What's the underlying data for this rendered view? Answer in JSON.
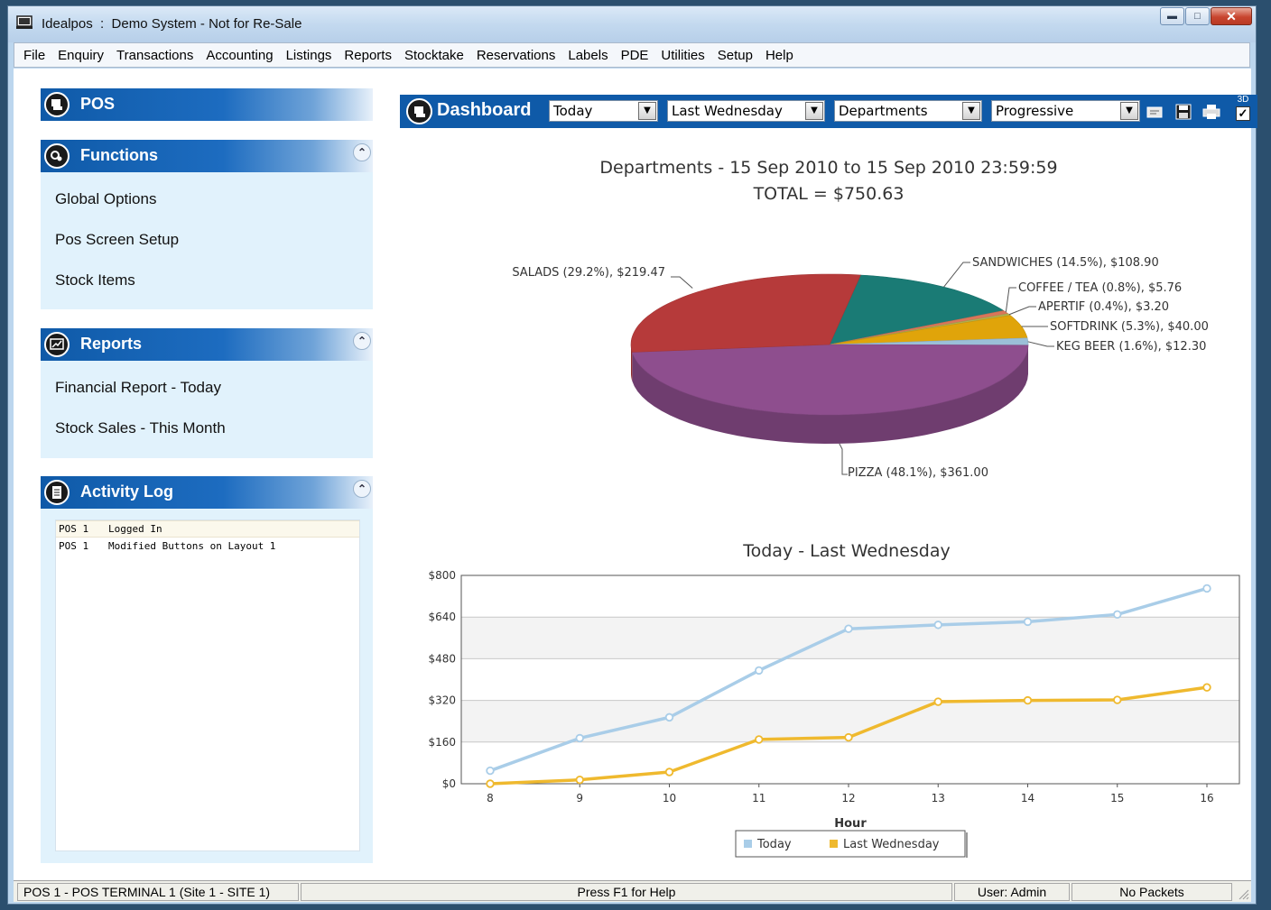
{
  "window": {
    "title": "Idealpos  :  Demo System - Not for Re-Sale"
  },
  "menu": [
    "File",
    "Enquiry",
    "Transactions",
    "Accounting",
    "Listings",
    "Reports",
    "Stocktake",
    "Reservations",
    "Labels",
    "PDE",
    "Utilities",
    "Setup",
    "Help"
  ],
  "pos_panel": {
    "title": "POS"
  },
  "functions": {
    "title": "Functions",
    "items": [
      "Global Options",
      "Pos Screen Setup",
      "Stock Items"
    ]
  },
  "reports": {
    "title": "Reports",
    "items": [
      "Financial Report - Today",
      "Stock Sales - This Month"
    ]
  },
  "activity_log": {
    "title": "Activity Log",
    "rows": [
      {
        "source": "POS 1",
        "message": "Logged In"
      },
      {
        "source": "POS 1",
        "message": "Modified Buttons on Layout 1"
      }
    ]
  },
  "dashboard": {
    "title": "Dashboard",
    "period": "Today",
    "compare": "Last Wednesday",
    "group_by": "Departments",
    "mode": "Progressive",
    "toggle_3d_label": "3D",
    "toggle_3d_checked": true
  },
  "pie_chart": {
    "title": "Departments - 15 Sep 2010 to 15 Sep 2010 23:59:59",
    "subtitle": "TOTAL = $750.63"
  },
  "line_chart": {
    "title": "Today - Last Wednesday"
  },
  "chart_data": [
    {
      "type": "pie",
      "title": "Departments - 15 Sep 2010 to 15 Sep 2010 23:59:59",
      "subtitle": "TOTAL = $750.63",
      "three_d": true,
      "slices": [
        {
          "name": "SANDWICHES",
          "label": "SANDWICHES (14.5%), $108.90",
          "value": 108.9,
          "percent": 14.5,
          "color": "#1a7b75"
        },
        {
          "name": "COFFEE / TEA",
          "label": "COFFEE / TEA (0.8%), $5.76",
          "value": 5.76,
          "percent": 0.8,
          "color": "#d9765a"
        },
        {
          "name": "APERTIF",
          "label": "APERTIF (0.4%), $3.20",
          "value": 3.2,
          "percent": 0.4,
          "color": "#b0b050"
        },
        {
          "name": "SOFTDRINK",
          "label": "SOFTDRINK (5.3%), $40.00",
          "value": 40.0,
          "percent": 5.3,
          "color": "#e0a40a"
        },
        {
          "name": "KEG BEER",
          "label": "KEG BEER (1.6%), $12.30",
          "value": 12.3,
          "percent": 1.6,
          "color": "#9bbfd8"
        },
        {
          "name": "PIZZA",
          "label": "PIZZA (48.1%), $361.00",
          "value": 361.0,
          "percent": 48.1,
          "color": "#8e4e8e"
        },
        {
          "name": "SALADS",
          "label": "SALADS (29.2%), $219.47",
          "value": 219.47,
          "percent": 29.2,
          "color": "#b63a3a"
        }
      ]
    },
    {
      "type": "line",
      "title": "Today - Last Wednesday",
      "xlabel": "Hour",
      "ylabel": "",
      "x": [
        8,
        9,
        10,
        11,
        12,
        13,
        14,
        15,
        16
      ],
      "ylim": [
        0,
        800
      ],
      "yticks": [
        "$0",
        "$160",
        "$320",
        "$480",
        "$640",
        "$800"
      ],
      "ytick_values": [
        0,
        160,
        320,
        480,
        640,
        800
      ],
      "grid": true,
      "legend_position": "bottom",
      "series": [
        {
          "name": "Today",
          "color": "#a9cde8",
          "values": [
            50,
            175,
            255,
            435,
            595,
            610,
            622,
            650,
            750
          ]
        },
        {
          "name": "Last Wednesday",
          "color": "#efb92e",
          "values": [
            0,
            15,
            45,
            170,
            178,
            315,
            320,
            322,
            370
          ]
        }
      ]
    }
  ],
  "statusbar": {
    "terminal": "POS 1  -  POS TERMINAL 1  (Site 1 - SITE 1)",
    "help": "Press F1 for Help",
    "user": "User: Admin",
    "packets": "No Packets"
  }
}
